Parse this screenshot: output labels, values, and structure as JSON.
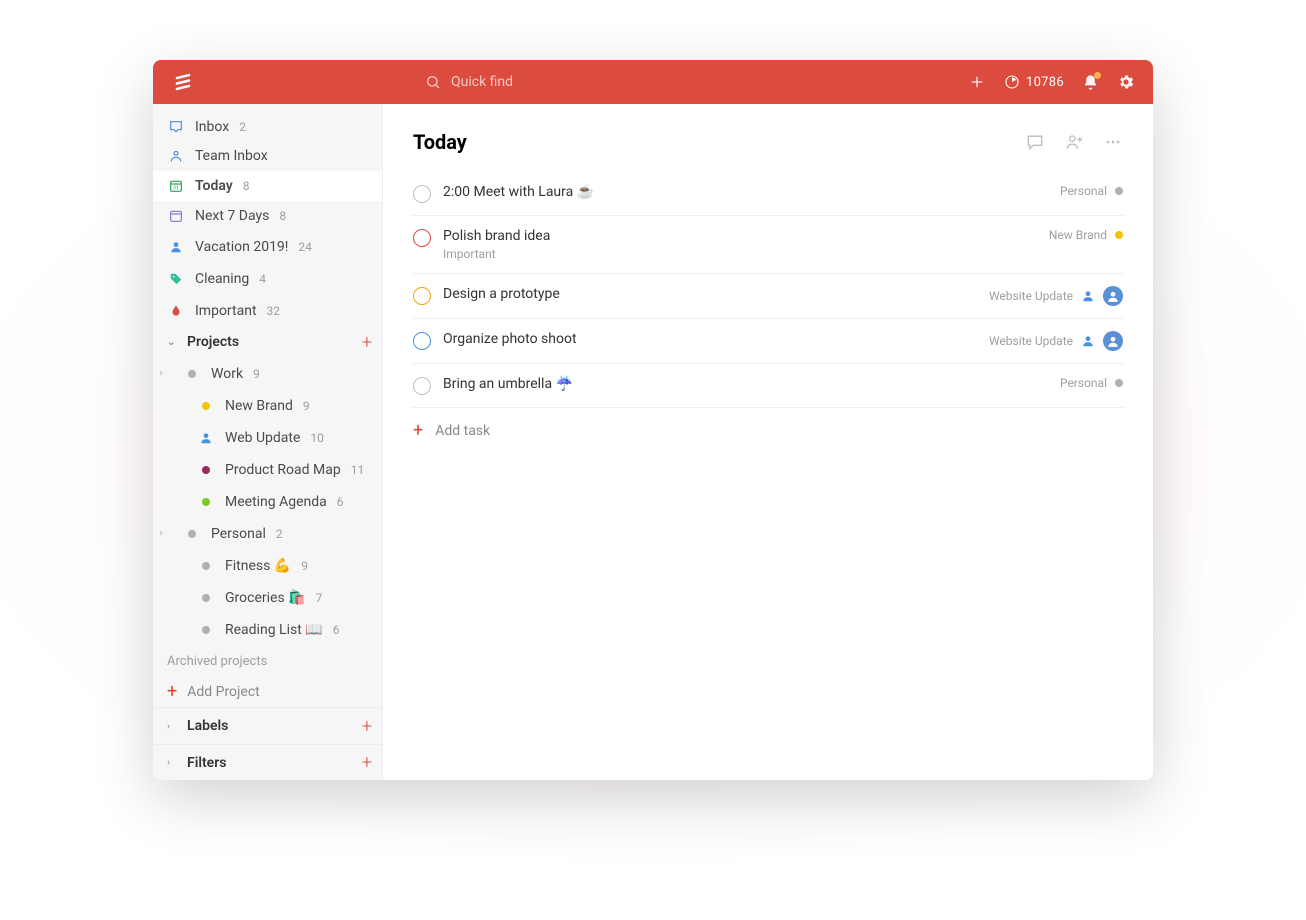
{
  "colors": {
    "brand": "#db4c3f",
    "p_red": "#db4c3f",
    "p_orange": "#f6a609",
    "p_blue": "#4a90e2",
    "p_purple": "#9b59b6",
    "p_green": "#7ecb20",
    "p_yellow": "#f3c200",
    "p_grey": "#b0b0b0"
  },
  "top": {
    "search_placeholder": "Quick find",
    "karma_points": "10786"
  },
  "sidebar": {
    "inbox": {
      "label": "Inbox",
      "count": "2"
    },
    "team_inbox": {
      "label": "Team Inbox"
    },
    "today": {
      "label": "Today",
      "count": "8"
    },
    "next7": {
      "label": "Next 7 Days",
      "count": "8"
    },
    "filters": [
      {
        "label": "Vacation 2019!",
        "count": "24",
        "icon": "user",
        "color": "#4a90e2"
      },
      {
        "label": "Cleaning",
        "count": "4",
        "icon": "tag",
        "color": "#2fbf9e"
      },
      {
        "label": "Important",
        "count": "32",
        "icon": "drop",
        "color": "#db4c3f"
      }
    ],
    "projects_label": "Projects",
    "projects": [
      {
        "label": "Work",
        "count": "9",
        "color": "#b0b0b0",
        "expandable": true,
        "children": [
          {
            "label": "New Brand",
            "count": "9",
            "color": "#f3c200"
          },
          {
            "label": "Web Update",
            "count": "10",
            "icon": "user",
            "color": "#4a90e2"
          },
          {
            "label": "Product Road Map",
            "count": "11",
            "color": "#9b2a5b"
          },
          {
            "label": "Meeting Agenda",
            "count": "6",
            "color": "#7ecb20"
          }
        ]
      },
      {
        "label": "Personal",
        "count": "2",
        "color": "#b0b0b0",
        "expandable": true,
        "children": [
          {
            "label": "Fitness 💪",
            "count": "9",
            "color": "#b0b0b0"
          },
          {
            "label": "Groceries 🛍️",
            "count": "7",
            "color": "#b0b0b0"
          },
          {
            "label": "Reading List 📖",
            "count": "6",
            "color": "#b0b0b0"
          }
        ]
      }
    ],
    "archived_label": "Archived projects",
    "add_project_label": "Add Project",
    "labels_label": "Labels",
    "filters_label": "Filters"
  },
  "main": {
    "title": "Today",
    "add_task_label": "Add task",
    "tasks": [
      {
        "title": "2:00 Meet with Laura ☕",
        "sub": "",
        "priority": "#c0c0c0",
        "project": "Personal",
        "pcolor": "#b0b0b0",
        "assignee": false
      },
      {
        "title": "Polish brand idea",
        "sub": "Important",
        "priority": "#db4c3f",
        "project": "New Brand",
        "pcolor": "#f3c200",
        "assignee": false
      },
      {
        "title": "Design a prototype",
        "sub": "",
        "priority": "#f6a609",
        "project": "Website Update",
        "pcolor": "#4a90e2",
        "assignee": true,
        "assignee_icon": "user"
      },
      {
        "title": "Organize photo shoot",
        "sub": "",
        "priority": "#4a90e2",
        "project": "Website Update",
        "pcolor": "#4a90e2",
        "assignee": true,
        "assignee_icon": "user"
      },
      {
        "title": "Bring an umbrella ☔",
        "sub": "",
        "priority": "#c0c0c0",
        "project": "Personal",
        "pcolor": "#b0b0b0",
        "assignee": false
      }
    ]
  }
}
